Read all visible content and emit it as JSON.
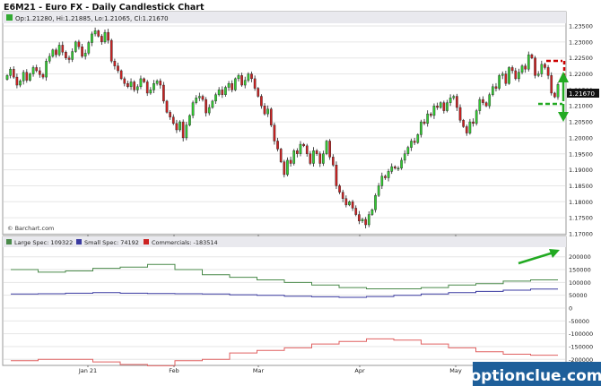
{
  "header": {
    "title": "E6M21 - Euro FX - Daily Candlestick Chart",
    "ohlc": "Op:1.21280, Hi:1.21885, Lo:1.21065, Cl:1.21670",
    "credit": "© Barchart.com",
    "watermark": "optionclue.com",
    "last_price_label": "1.21670"
  },
  "colors": {
    "up": "#33cc33",
    "down": "#cc2222",
    "large_spec": "#4a8a4a",
    "small_spec": "#3a3aa0",
    "commercials": "#e06060",
    "annotation": "#22aa22",
    "annotation_red": "#cc0000",
    "watermark_bg": "#1e5f9a"
  },
  "chart_data": [
    {
      "type": "candlestick",
      "title": "E6M21 - Euro FX - Daily Candlestick Chart",
      "x_labels": [
        "Jan 21",
        "Feb",
        "Mar",
        "Apr",
        "May"
      ],
      "ylim": [
        1.17,
        1.235
      ],
      "y_ticks": [
        "1.23500",
        "1.23000",
        "1.22500",
        "1.22000",
        "1.21500",
        "1.21000",
        "1.20500",
        "1.20000",
        "1.19500",
        "1.19000",
        "1.18500",
        "1.18000",
        "1.17500",
        "1.17000"
      ],
      "last_price": 1.2167,
      "grid": true,
      "closes": [
        1.2195,
        1.2215,
        1.219,
        1.2165,
        1.2178,
        1.2205,
        1.218,
        1.22,
        1.222,
        1.221,
        1.2198,
        1.219,
        1.224,
        1.2255,
        1.2275,
        1.226,
        1.229,
        1.2268,
        1.225,
        1.2245,
        1.227,
        1.23,
        1.2285,
        1.2255,
        1.2265,
        1.2298,
        1.2325,
        1.2335,
        1.2318,
        1.23,
        1.233,
        1.2305,
        1.224,
        1.2225,
        1.221,
        1.2185,
        1.217,
        1.216,
        1.2175,
        1.215,
        1.216,
        1.2185,
        1.2175,
        1.214,
        1.215,
        1.217,
        1.2178,
        1.2165,
        1.2115,
        1.208,
        1.2065,
        1.2045,
        1.2025,
        1.205,
        1.2,
        1.204,
        1.207,
        1.211,
        1.2125,
        1.213,
        1.212,
        1.2078,
        1.2095,
        1.2115,
        1.2135,
        1.215,
        1.2135,
        1.2158,
        1.217,
        1.215,
        1.2185,
        1.2195,
        1.2165,
        1.218,
        1.22,
        1.2185,
        1.2155,
        1.213,
        1.21,
        1.2075,
        1.209,
        1.204,
        1.199,
        1.1965,
        1.1925,
        1.1885,
        1.193,
        1.192,
        1.196,
        1.195,
        1.198,
        1.1975,
        1.195,
        1.192,
        1.196,
        1.195,
        1.192,
        1.195,
        1.199,
        1.194,
        1.1915,
        1.185,
        1.183,
        1.181,
        1.179,
        1.18,
        1.178,
        1.176,
        1.174,
        1.1745,
        1.1728,
        1.176,
        1.1775,
        1.182,
        1.185,
        1.188,
        1.1875,
        1.1895,
        1.191,
        1.1905,
        1.1905,
        1.193,
        1.195,
        1.197,
        1.199,
        1.1985,
        1.201,
        1.205,
        1.2045,
        1.2075,
        1.207,
        1.21,
        1.2095,
        1.211,
        1.2085,
        1.211,
        1.2125,
        1.213,
        1.2095,
        1.2055,
        1.2035,
        1.2015,
        1.205,
        1.2045,
        1.2085,
        1.212,
        1.211,
        1.21,
        1.2135,
        1.216,
        1.2155,
        1.2195,
        1.22,
        1.217,
        1.222,
        1.221,
        1.2185,
        1.2205,
        1.2225,
        1.2215,
        1.226,
        1.225,
        1.2195,
        1.22,
        1.223,
        1.222,
        1.2195,
        1.214,
        1.2128,
        1.2167
      ]
    },
    {
      "type": "line",
      "title": "",
      "x_labels": [
        "Jan 21",
        "Feb",
        "Mar",
        "Apr",
        "May"
      ],
      "ylim": [
        -220000,
        220000
      ],
      "y_ticks": [
        "200000",
        "150000",
        "100000",
        "50000",
        "0",
        "-50000",
        "-100000",
        "-150000",
        "-200000"
      ],
      "legend_position": "top-left",
      "series": [
        {
          "name": "Large Spec: 109322",
          "values": [
            150000,
            140000,
            145000,
            155000,
            160000,
            170000,
            150000,
            130000,
            120000,
            110000,
            100000,
            90000,
            80000,
            75000,
            75000,
            80000,
            90000,
            95000,
            105000,
            110000
          ]
        },
        {
          "name": "Small Spec: 74192",
          "values": [
            55000,
            56000,
            58000,
            60000,
            58000,
            57000,
            56000,
            55000,
            52000,
            50000,
            46000,
            44000,
            42000,
            45000,
            50000,
            55000,
            60000,
            65000,
            70000,
            74192
          ]
        },
        {
          "name": "Commercials: -183514",
          "values": [
            -205000,
            -200000,
            -200000,
            -210000,
            -220000,
            -225000,
            -205000,
            -200000,
            -175000,
            -165000,
            -155000,
            -140000,
            -130000,
            -120000,
            -125000,
            -140000,
            -155000,
            -170000,
            -180000,
            -183514
          ]
        }
      ]
    }
  ]
}
